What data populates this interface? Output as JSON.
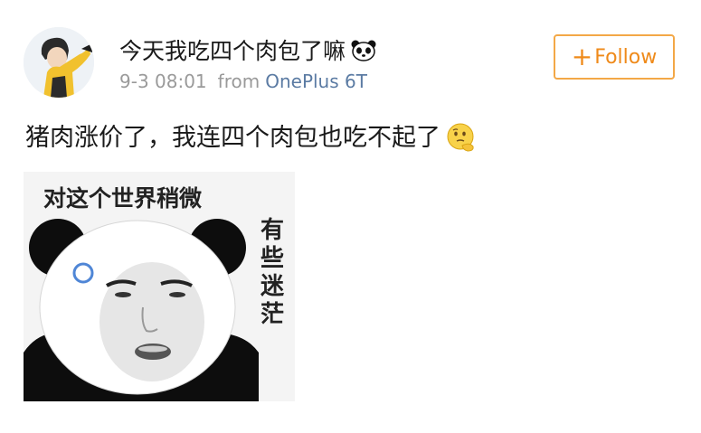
{
  "post": {
    "username": "今天我吃四个肉包了嘛",
    "username_emoji": "panda-emoji",
    "timestamp": "9-3 08:01",
    "from_label": "from",
    "device": "OnePlus 6T",
    "follow": {
      "plus": "+",
      "label": "Follow"
    },
    "text": "猪肉涨价了，我连四个肉包也吃不起了",
    "text_emoji": "thinking-face-emoji"
  },
  "meme": {
    "caption_top": "对这个世界稍微",
    "caption_side": "有些迷茫"
  },
  "colors": {
    "accent": "#ef8a1a",
    "follow_border": "#f3a847",
    "device_link": "#5b7ba3",
    "meta_gray": "#9a9a9a"
  }
}
